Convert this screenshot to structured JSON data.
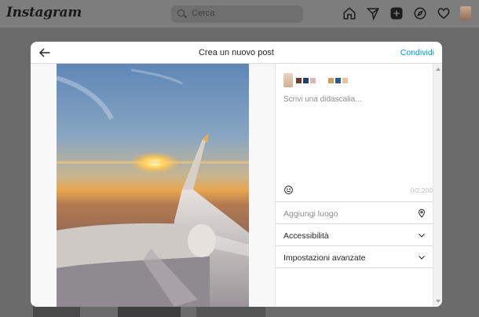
{
  "app": {
    "logo": "Instagram"
  },
  "search": {
    "placeholder": "Cerca"
  },
  "nav": {
    "icons": [
      "home-icon",
      "messenger-icon",
      "new-post-icon",
      "explore-icon",
      "heart-icon",
      "avatar"
    ]
  },
  "modal": {
    "title": "Crea un nuovo post",
    "share_label": "Condividi",
    "back_icon": "arrow-left-icon",
    "caption_placeholder": "Scrivi una didascalia...",
    "char_counter": "0/2,200",
    "rows": [
      {
        "label": "Aggiungi luogo",
        "icon": "location-pin-icon"
      },
      {
        "label": "Accessibilità",
        "icon": "chevron-down-icon"
      },
      {
        "label": "Impostazioni avanzate",
        "icon": "chevron-down-icon"
      }
    ]
  },
  "colors": {
    "accent": "#0095f6",
    "overlay": "#6b6b6b"
  }
}
